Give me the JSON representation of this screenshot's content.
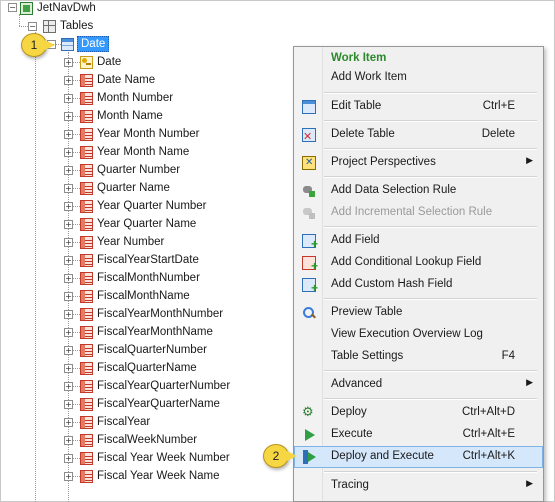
{
  "tree": {
    "root_label": "JetNavDwh",
    "tables_label": "Tables",
    "selected_table": "Date",
    "fields": [
      "Date",
      "Date Name",
      "Month Number",
      "Month Name",
      "Year Month Number",
      "Year Month Name",
      "Quarter Number",
      "Quarter Name",
      "Year Quarter Number",
      "Year Quarter Name",
      "Year Number",
      "FiscalYearStartDate",
      "FiscalMonthNumber",
      "FiscalMonthName",
      "FiscalYearMonthNumber",
      "FiscalYearMonthName",
      "FiscalQuarterNumber",
      "FiscalQuarterName",
      "FiscalYearQuarterNumber",
      "FiscalYearQuarterName",
      "FiscalYear",
      "FiscalWeekNumber",
      "Fiscal Year Week Number",
      "Fiscal Year Week Name"
    ]
  },
  "menu": {
    "header": "Work Item",
    "items": [
      {
        "label": "Add Work Item",
        "shortcut": "",
        "icon": "none"
      },
      {
        "label": "Edit Table",
        "shortcut": "Ctrl+E",
        "icon": "table-icon"
      },
      {
        "label": "Delete Table",
        "shortcut": "Delete",
        "icon": "delete-table-icon"
      },
      {
        "label": "Project Perspectives",
        "shortcut": "",
        "icon": "perspectives-icon",
        "submenu": true
      },
      {
        "label": "Add Data Selection Rule",
        "shortcut": "",
        "icon": "rule-icon"
      },
      {
        "label": "Add Incremental Selection Rule",
        "shortcut": "",
        "icon": "rule-icon",
        "disabled": true
      },
      {
        "label": "Add Field",
        "shortcut": "",
        "icon": "add-field-icon"
      },
      {
        "label": "Add Conditional Lookup Field",
        "shortcut": "",
        "icon": "conditional-lookup-icon"
      },
      {
        "label": "Add Custom Hash Field",
        "shortcut": "",
        "icon": "hash-field-icon"
      },
      {
        "label": "Preview Table",
        "shortcut": "",
        "icon": "search-icon"
      },
      {
        "label": "View Execution Overview Log",
        "shortcut": "",
        "icon": "none"
      },
      {
        "label": "Table Settings",
        "shortcut": "F4",
        "icon": "none"
      },
      {
        "label": "Advanced",
        "shortcut": "",
        "icon": "none",
        "submenu": true
      },
      {
        "label": "Deploy",
        "shortcut": "Ctrl+Alt+D",
        "icon": "deploy-icon"
      },
      {
        "label": "Execute",
        "shortcut": "Ctrl+Alt+E",
        "icon": "execute-icon"
      },
      {
        "label": "Deploy and Execute",
        "shortcut": "Ctrl+Alt+K",
        "icon": "deploy-execute-icon",
        "highlighted": true
      },
      {
        "label": "Tracing",
        "shortcut": "",
        "icon": "none",
        "submenu": true
      }
    ]
  },
  "callouts": {
    "one": "1",
    "two": "2"
  },
  "colors": {
    "selection": "#3399ff",
    "menu_highlight": "#d5e7fb",
    "header_green": "#2c8a2c",
    "callout_yellow": "#f6d743"
  }
}
